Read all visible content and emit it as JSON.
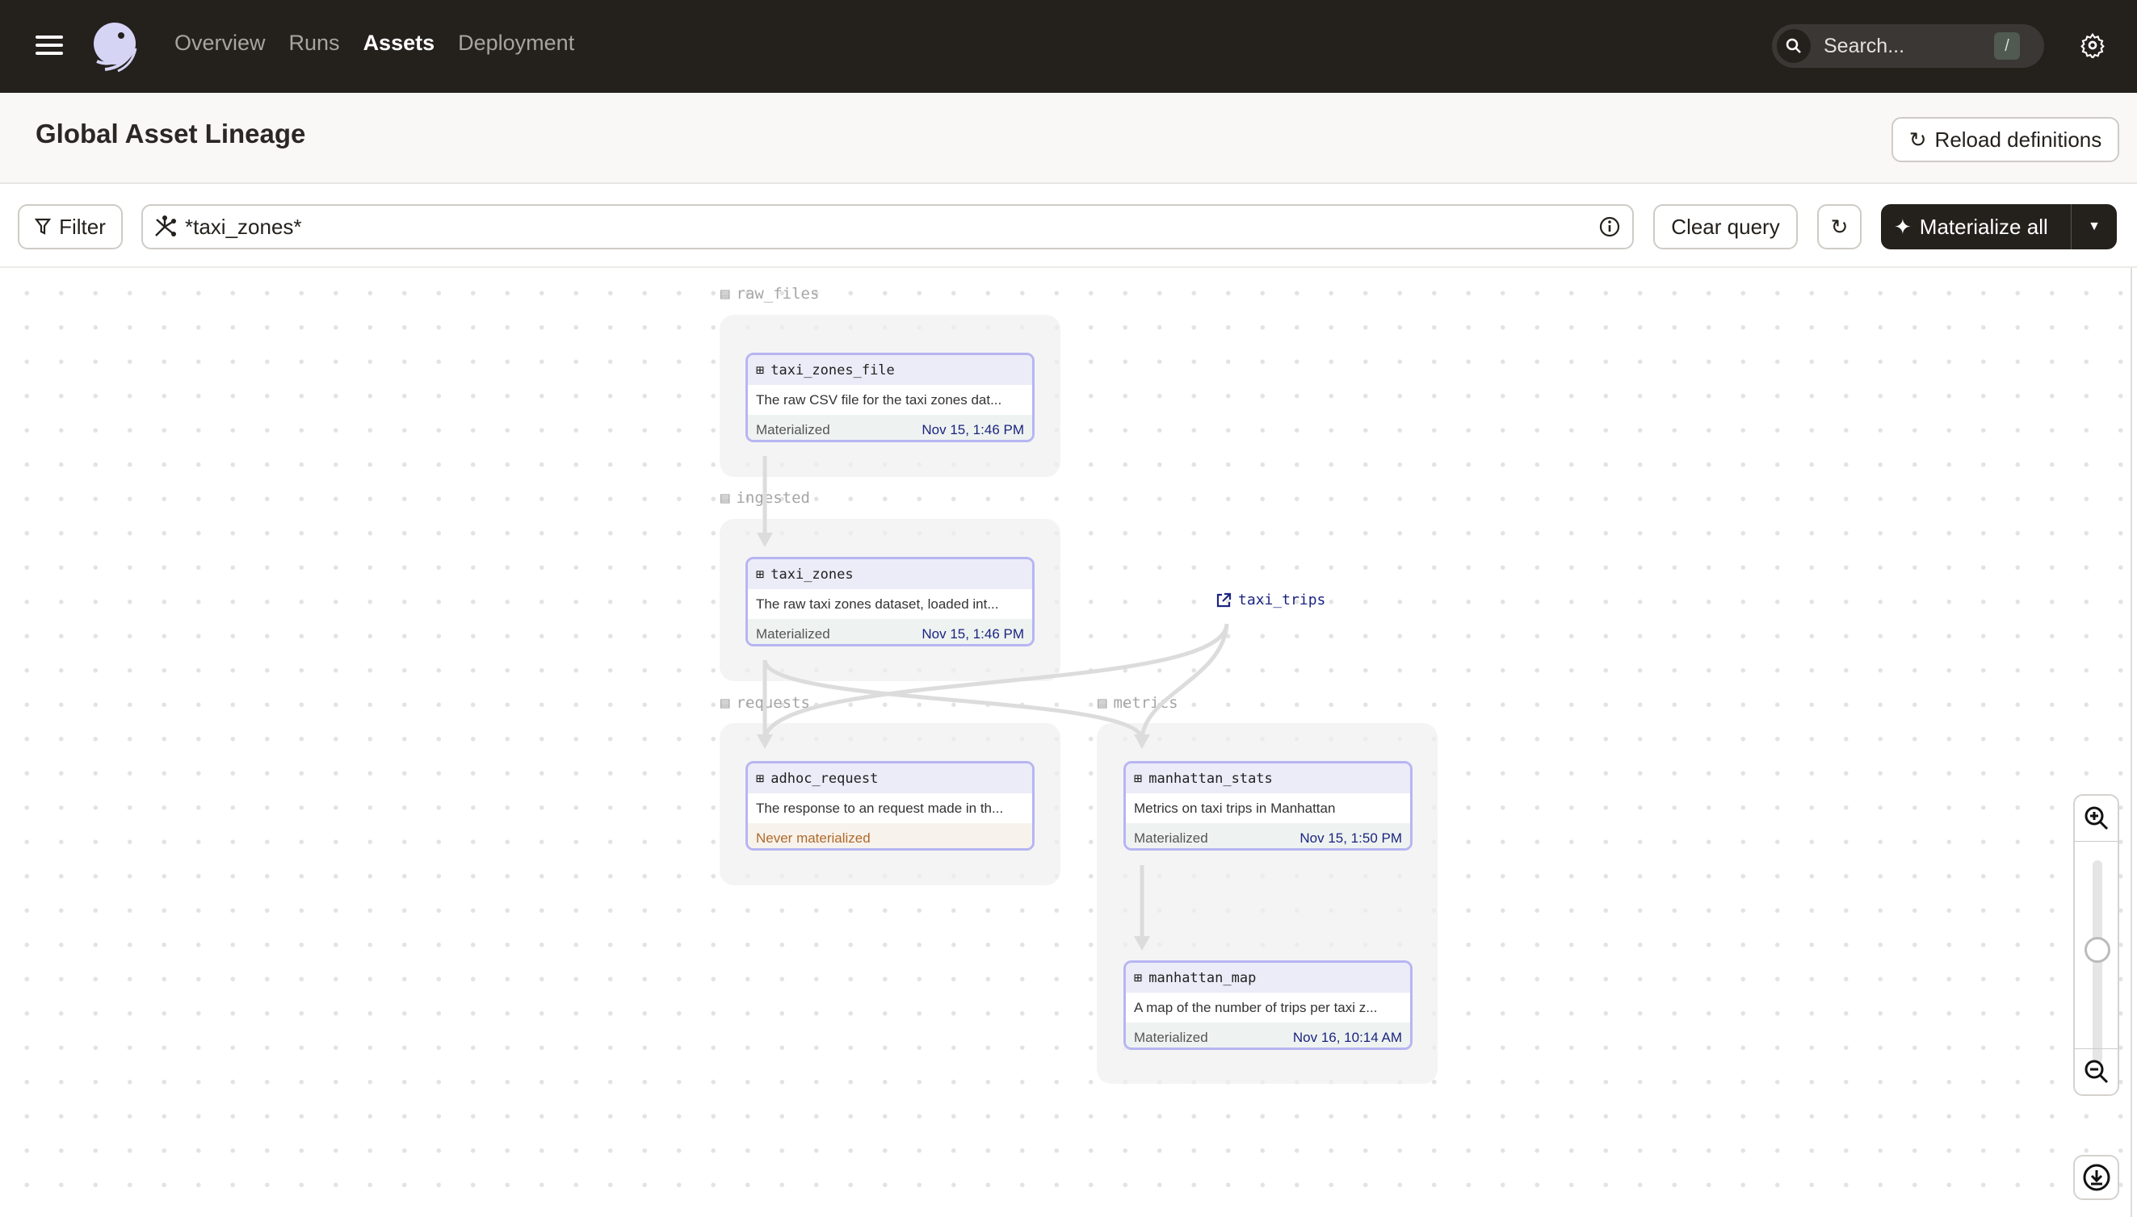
{
  "nav": {
    "items": [
      {
        "label": "Overview",
        "active": false
      },
      {
        "label": "Runs",
        "active": false
      },
      {
        "label": "Assets",
        "active": true
      },
      {
        "label": "Deployment",
        "active": false
      }
    ],
    "search_placeholder": "Search...",
    "search_shortcut": "/"
  },
  "header": {
    "title": "Global Asset Lineage",
    "reload_label": "Reload definitions"
  },
  "toolbar": {
    "filter_label": "Filter",
    "query_value": "*taxi_zones*",
    "clear_label": "Clear query",
    "materialize_label": "Materialize all"
  },
  "groups": {
    "raw_files": "raw_files",
    "ingested": "ingested",
    "requests": "requests",
    "metrics": "metrics"
  },
  "nodes": {
    "taxi_zones_file": {
      "name": "taxi_zones_file",
      "description": "The raw CSV file for the taxi zones dat...",
      "status": "Materialized",
      "time": "Nov 15, 1:46 PM"
    },
    "taxi_zones": {
      "name": "taxi_zones",
      "description": "The raw taxi zones dataset, loaded int...",
      "status": "Materialized",
      "time": "Nov 15, 1:46 PM"
    },
    "adhoc_request": {
      "name": "adhoc_request",
      "description": "The response to an request made in th...",
      "status": "Never materialized"
    },
    "manhattan_stats": {
      "name": "manhattan_stats",
      "description": "Metrics on taxi trips in Manhattan",
      "status": "Materialized",
      "time": "Nov 15, 1:50 PM"
    },
    "manhattan_map": {
      "name": "manhattan_map",
      "description": "A map of the number of trips per taxi z...",
      "status": "Materialized",
      "time": "Nov 16, 10:14 AM"
    }
  },
  "external_asset": "taxi_trips",
  "zoom_level_fraction": 0.4,
  "colors": {
    "nav_bg": "#24201c",
    "node_border": "#b7b5f2",
    "materialized_time": "#1c2480",
    "never_materialized": "#b0692a"
  }
}
